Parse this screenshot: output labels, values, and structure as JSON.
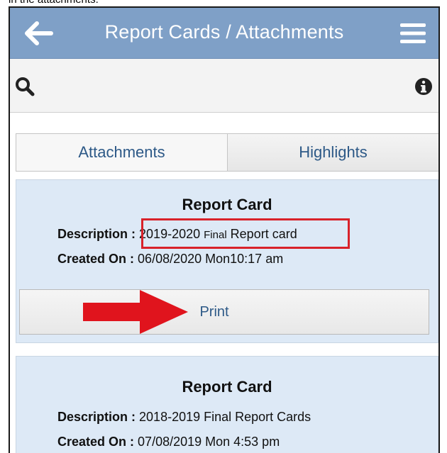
{
  "caption": "in the attachments.",
  "navbar": {
    "title": "Report Cards / Attachments",
    "back_icon": "back-arrow-icon",
    "menu_icon": "hamburger-menu-icon",
    "color": "#7fa0c7"
  },
  "toolbar": {
    "search_icon": "search-icon",
    "info_icon": "info-icon"
  },
  "tabs": [
    {
      "label": "Attachments",
      "active": true
    },
    {
      "label": "Highlights",
      "active": false
    }
  ],
  "cards": [
    {
      "title": "Report Card",
      "description_label": "Description :",
      "description_year": "2019-2020",
      "description_final": "Final",
      "description_rest": "Report card",
      "created_label": "Created On :",
      "created_value": "06/08/2020 Mon10:17 am",
      "print_label": "Print"
    },
    {
      "title": "Report Card",
      "description_label": "Description :",
      "description_value": "2018-2019 Final Report Cards",
      "created_label": "Created On :",
      "created_value": "07/08/2019 Mon 4:53 pm"
    }
  ],
  "annotation": {
    "highlight_color": "#d8222a",
    "arrow_color": "#e0141d"
  }
}
